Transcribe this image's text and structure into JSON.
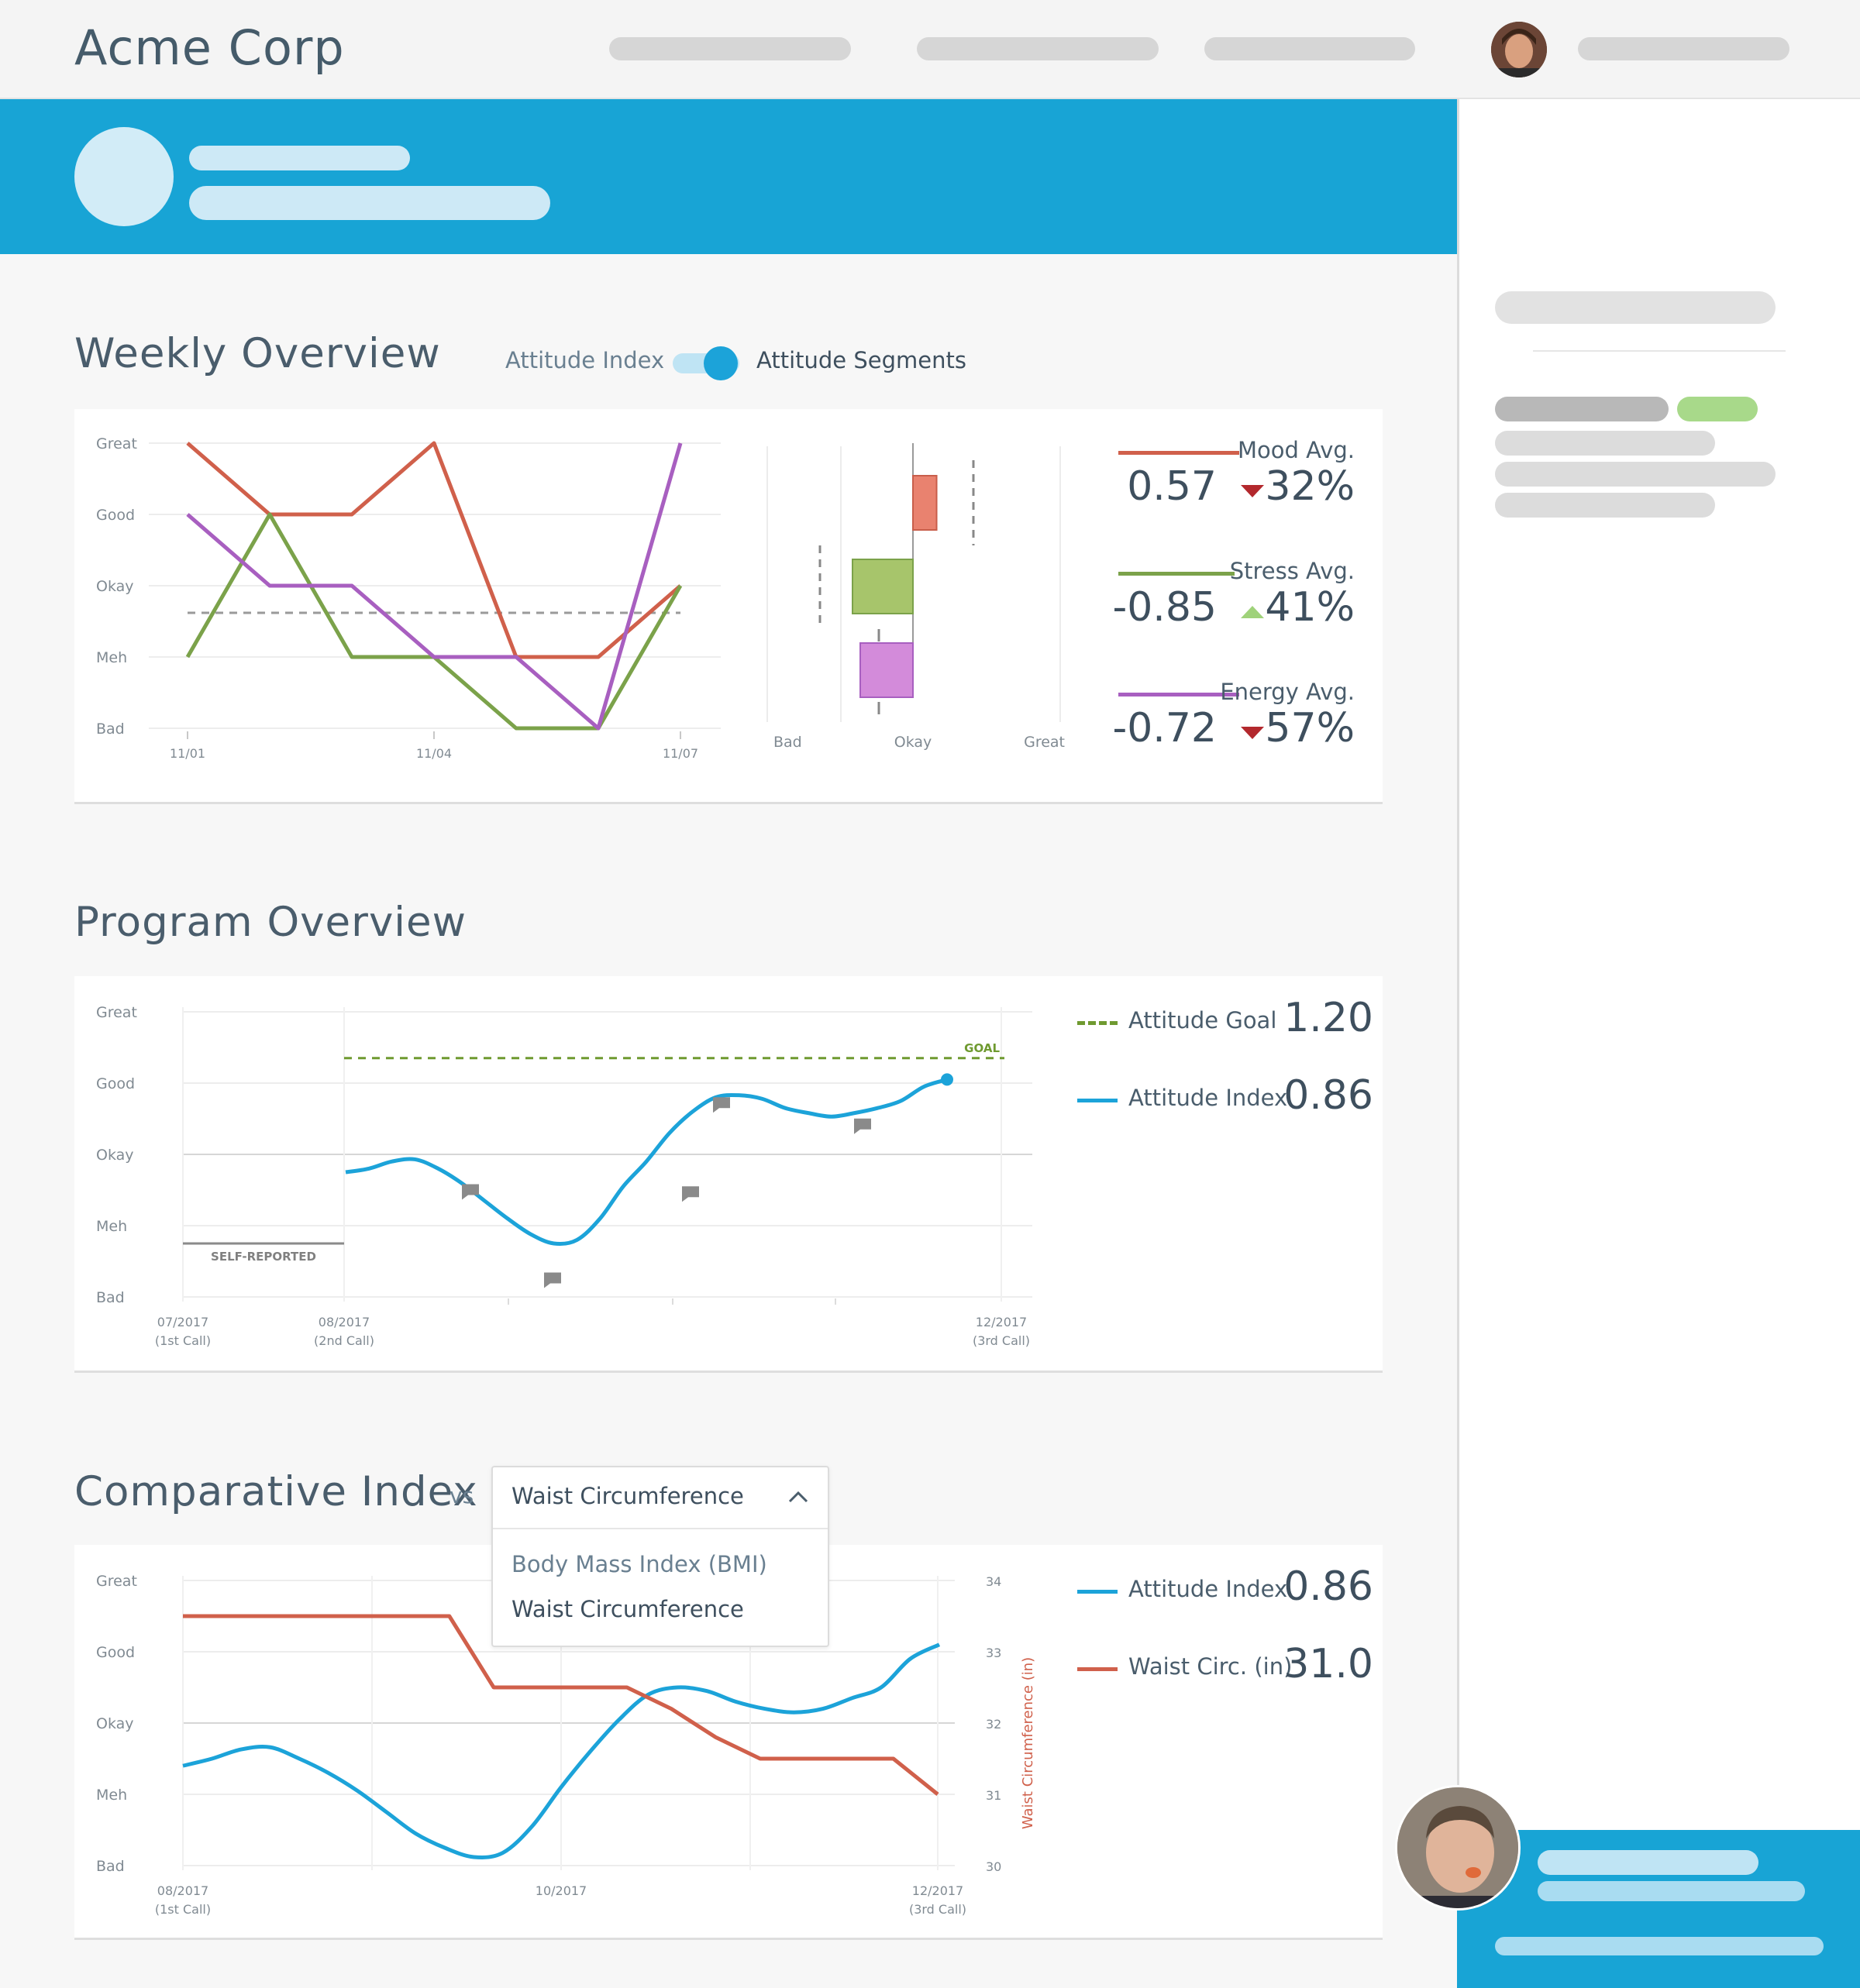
{
  "app": {
    "brand": "Acme Corp"
  },
  "colors": {
    "accent": "#18a4d5",
    "mood": "#d0604b",
    "stress": "#7ba24a",
    "energy": "#a85fc0",
    "attitude": "#1ca3d9",
    "goal": "#6f9a30",
    "waist": "#d0604b"
  },
  "weekly": {
    "title": "Weekly Overview",
    "toggle": {
      "left_label": "Attitude Index",
      "right_label": "Attitude Segments",
      "on": true
    },
    "chart_data": {
      "type": "line",
      "y_categories": [
        "Bad",
        "Meh",
        "Okay",
        "Good",
        "Great"
      ],
      "x_ticks": [
        "11/01",
        "11/04",
        "11/07"
      ],
      "x": [
        1,
        2,
        3,
        4,
        5,
        6,
        7
      ],
      "series": [
        {
          "name": "Mood Avg.",
          "values": [
            4,
            3,
            3,
            4,
            1,
            1,
            2
          ]
        },
        {
          "name": "Stress Avg.",
          "values": [
            1,
            3,
            1,
            1,
            0,
            0,
            2
          ]
        },
        {
          "name": "Energy Avg.",
          "values": [
            3,
            2,
            2,
            1,
            1,
            0,
            4
          ]
        }
      ],
      "reference_line": 1.62
    },
    "segments": {
      "type": "box",
      "x_ticks": [
        "Bad",
        "Okay",
        "Great"
      ],
      "boxes": [
        {
          "name": "Mood Avg.",
          "low": 0.0,
          "high": 0.57
        },
        {
          "name": "Stress Avg.",
          "low": -0.85,
          "high": 0.0
        },
        {
          "name": "Energy Avg.",
          "low": -0.72,
          "high": 0.0
        }
      ]
    },
    "legend": [
      {
        "name": "Mood Avg.",
        "value": "0.57",
        "trend": "down",
        "pct": "32%"
      },
      {
        "name": "Stress Avg.",
        "value": "-0.85",
        "trend": "up",
        "pct": "41%"
      },
      {
        "name": "Energy Avg.",
        "value": "-0.72",
        "trend": "down",
        "pct": "57%"
      }
    ]
  },
  "program": {
    "title": "Program Overview",
    "chart_data": {
      "type": "line",
      "y_categories": [
        "Bad",
        "Meh",
        "Okay",
        "Good",
        "Great"
      ],
      "x_ticks": [
        {
          "date": "07/2017",
          "note": "(1st Call)"
        },
        {
          "date": "08/2017",
          "note": "(2nd Call)"
        },
        {
          "date": "12/2017",
          "note": "(3rd Call)"
        }
      ],
      "self_reported_label": "SELF-REPORTED",
      "self_reported_value": 0.75,
      "goal_label": "GOAL",
      "goal_value": 3.35,
      "attitude_index": [
        1.75,
        1.8,
        1.9,
        1.93,
        1.8,
        1.6,
        1.35,
        1.1,
        0.88,
        0.75,
        0.8,
        1.1,
        1.55,
        1.9,
        2.3,
        2.6,
        2.8,
        2.83,
        2.78,
        2.65,
        2.58,
        2.53,
        2.58,
        2.65,
        2.75,
        2.95,
        3.05
      ]
    },
    "legend": [
      {
        "name": "Attitude Goal",
        "value": "1.20",
        "style": "dashed"
      },
      {
        "name": "Attitude Index",
        "value": "0.86",
        "style": "solid"
      }
    ]
  },
  "comparative": {
    "title": "Comparative Index",
    "vs": "vs",
    "select": {
      "value": "Waist Circumference",
      "options": [
        "Body Mass Index (BMI)",
        "Waist Circumference"
      ]
    },
    "chart_data": {
      "type": "line",
      "y_categories": [
        "Bad",
        "Meh",
        "Okay",
        "Good",
        "Great"
      ],
      "y2_ticks": [
        30,
        31,
        32,
        33,
        34
      ],
      "y2_label": "Waist Circumference (in)",
      "x_ticks": [
        {
          "date": "08/2017",
          "note": "(1st Call)"
        },
        {
          "date": "10/2017",
          "note": ""
        },
        {
          "date": "12/2017",
          "note": "(3rd Call)"
        }
      ],
      "attitude_index": [
        1.4,
        1.5,
        1.63,
        1.66,
        1.5,
        1.3,
        1.05,
        0.75,
        0.45,
        0.25,
        0.12,
        0.18,
        0.55,
        1.1,
        1.6,
        2.05,
        2.4,
        2.5,
        2.45,
        2.3,
        2.2,
        2.15,
        2.2,
        2.35,
        2.5,
        2.9,
        3.1
      ],
      "waist_circ": [
        33.5,
        33.5,
        33.5,
        33.5,
        33.5,
        33.5,
        33.5,
        32.5,
        32.5,
        32.5,
        32.5,
        32.2,
        31.8,
        31.5,
        31.5,
        31.5,
        31.5,
        31.0
      ]
    },
    "legend": [
      {
        "name": "Attitude Index",
        "value": "0.86"
      },
      {
        "name": "Waist Circ. (in)",
        "value": "31.0"
      }
    ]
  }
}
